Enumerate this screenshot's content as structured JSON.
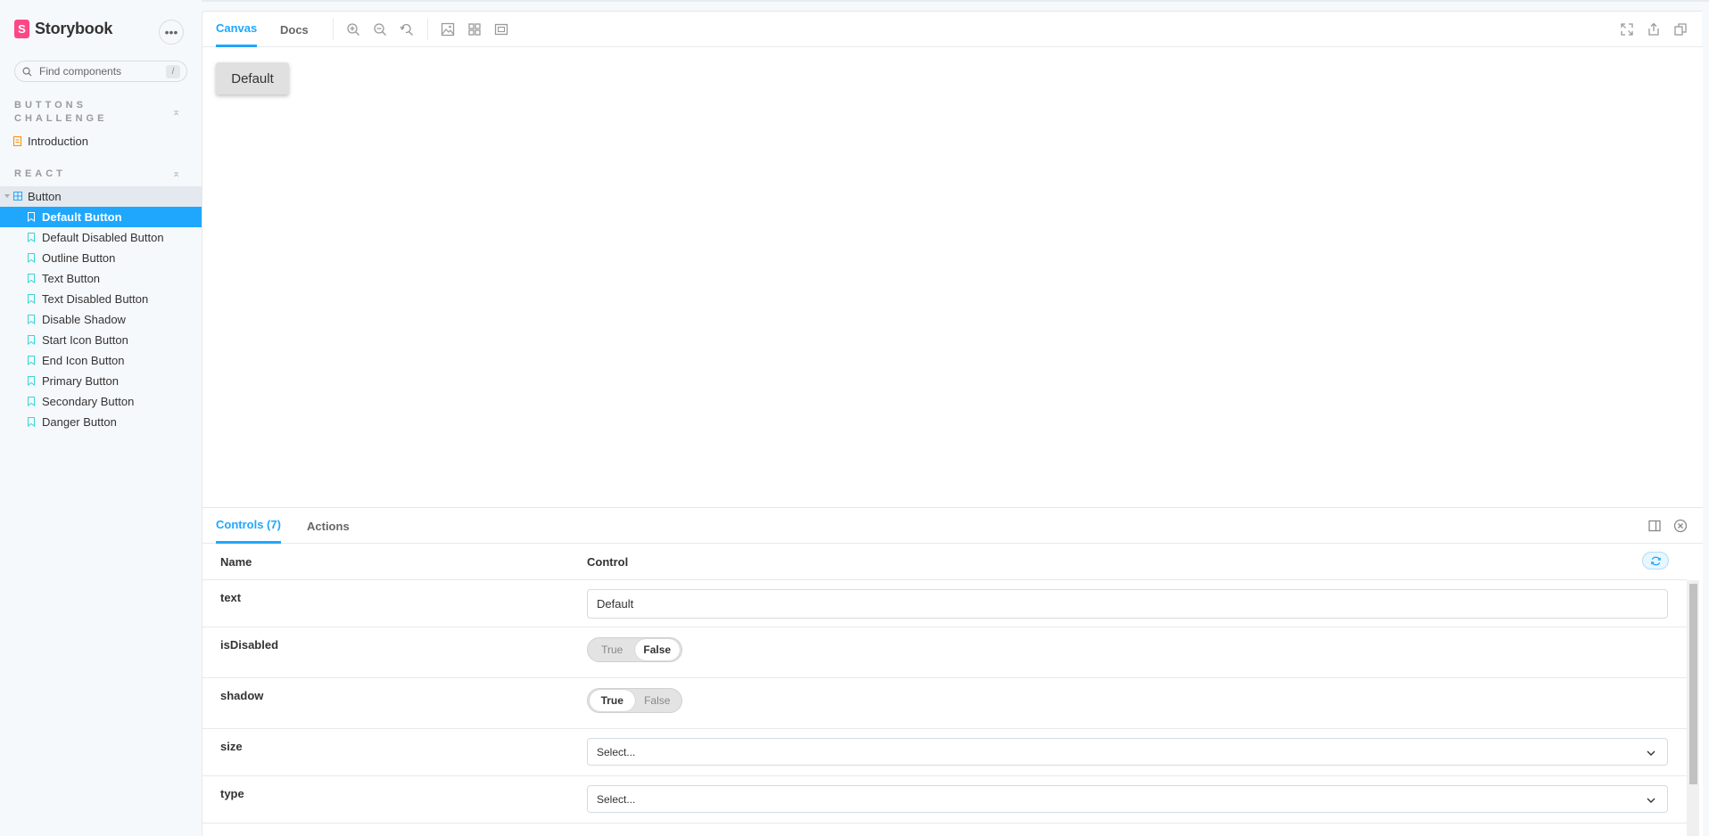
{
  "app": {
    "name": "Storybook",
    "logo_letter": "S"
  },
  "sidebar": {
    "menu_label": "•••",
    "search": {
      "placeholder": "Find components",
      "shortcut": "/"
    },
    "groups": [
      {
        "title": "BUTTONS CHALLENGE",
        "collapse": "⌅"
      },
      {
        "title": "REACT",
        "collapse": "⌅"
      }
    ],
    "docs": [
      {
        "label": "Introduction"
      }
    ],
    "component": {
      "label": "Button"
    },
    "stories": [
      {
        "label": "Default Button",
        "selected": true
      },
      {
        "label": "Default Disabled Button"
      },
      {
        "label": "Outline Button"
      },
      {
        "label": "Text Button"
      },
      {
        "label": "Text Disabled Button"
      },
      {
        "label": "Disable Shadow"
      },
      {
        "label": "Start Icon Button"
      },
      {
        "label": "End Icon Button"
      },
      {
        "label": "Primary Button"
      },
      {
        "label": "Secondary Button"
      },
      {
        "label": "Danger Button"
      }
    ]
  },
  "toolbar": {
    "tabs": [
      {
        "label": "Canvas",
        "active": true
      },
      {
        "label": "Docs"
      }
    ],
    "tools": [
      "zoom-in-icon",
      "zoom-out-icon",
      "zoom-reset-icon",
      "background-icon",
      "grid-icon",
      "outline-icon"
    ],
    "right_tools": [
      "fullscreen-icon",
      "share-icon",
      "copy-link-icon"
    ]
  },
  "canvas": {
    "button_label": "Default"
  },
  "addons": {
    "tabs": [
      {
        "label": "Controls (7)",
        "active": true
      },
      {
        "label": "Actions"
      }
    ],
    "header": {
      "name": "Name",
      "control": "Control"
    },
    "rows": [
      {
        "name": "text",
        "value": "Default"
      },
      {
        "name": "isDisabled",
        "true_label": "True",
        "false_label": "False",
        "value": false
      },
      {
        "name": "shadow",
        "true_label": "True",
        "false_label": "False",
        "value": true
      },
      {
        "name": "size",
        "select_value": "Select..."
      },
      {
        "name": "type",
        "select_value": "Select..."
      }
    ]
  },
  "colors": {
    "accent": "#1EA7FD",
    "brand": "#FF4785",
    "sidebar_bg": "#F6F9FC"
  }
}
